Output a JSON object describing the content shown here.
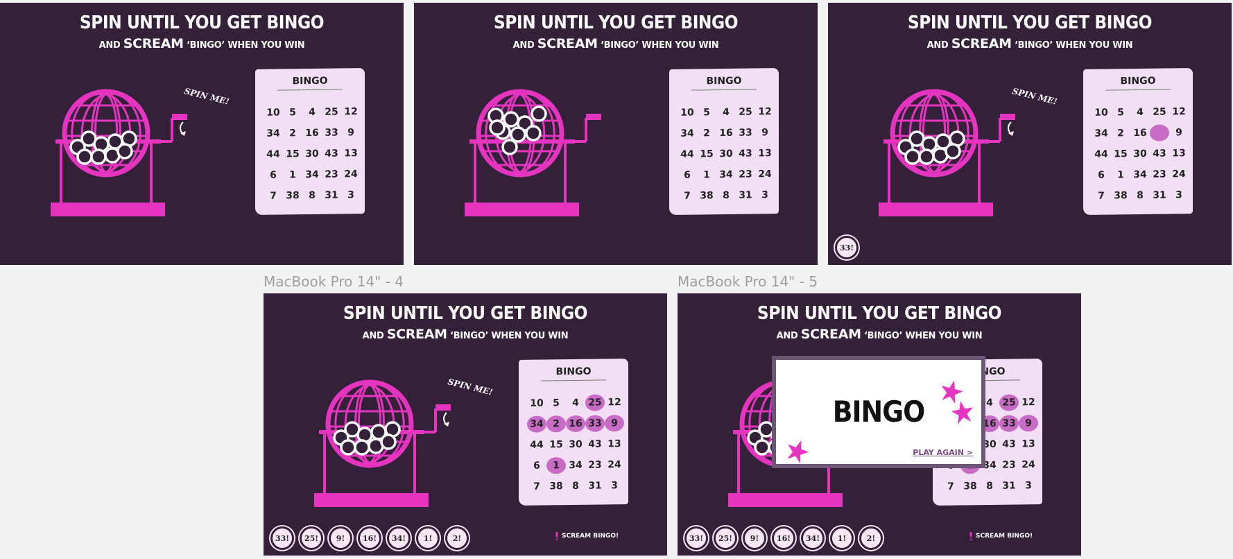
{
  "colors": {
    "background": "#35203a",
    "accent": "#e535c0",
    "card": "#f2dff5",
    "marked": "#c76bc4",
    "modal_border": "#6d5577"
  },
  "frame_labels": [
    "MacBook Pro 14\" - 4",
    "MacBook Pro 14\" - 5"
  ],
  "header": {
    "title": "SPIN UNTIL YOU GET BINGO",
    "sub_and": "AND",
    "sub_scream": "SCREAM",
    "sub_rest": "‘BINGO’ WHEN YOU WIN"
  },
  "spin_label": "SPIN ME!",
  "card_title": "BINGO",
  "card_numbers": [
    [
      "10",
      "5",
      "4",
      "25",
      "12"
    ],
    [
      "34",
      "2",
      "16",
      "33",
      "9"
    ],
    [
      "44",
      "15",
      "30",
      "43",
      "13"
    ],
    [
      "6",
      "1",
      "34",
      "23",
      "24"
    ],
    [
      "7",
      "38",
      "8",
      "31",
      "3"
    ]
  ],
  "frame3_balls": [
    "33!"
  ],
  "called_balls": [
    "33!",
    "25!",
    "9!",
    "16!",
    "34!",
    "1!",
    "2!"
  ],
  "scream_label": "SCREAM BINGO!",
  "modal": {
    "title": "BINGO",
    "play_again": "PLAY AGAIN >"
  },
  "icons": [
    "bingo-cage-icon",
    "crank-handle-icon",
    "rotate-arrow-icon",
    "microphone-icon",
    "star-icon"
  ]
}
